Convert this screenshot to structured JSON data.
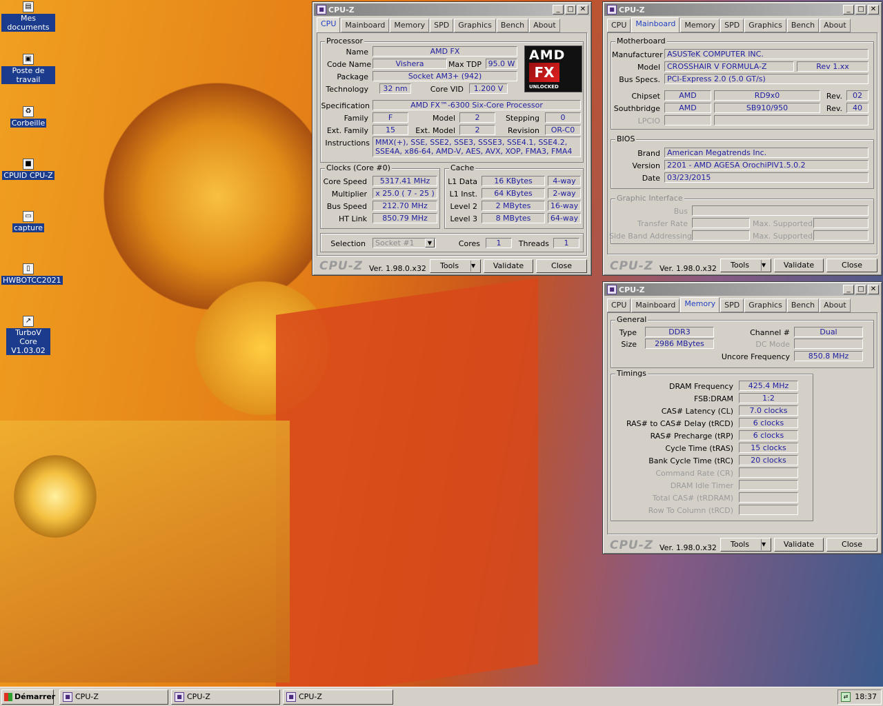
{
  "desktop": {
    "icons": [
      {
        "label": "Mes documents",
        "icon": "folder-icon"
      },
      {
        "label": "Poste de travail",
        "icon": "computer-icon"
      },
      {
        "label": "Corbeille",
        "icon": "recycle-bin-icon"
      },
      {
        "label": "CPUID CPU-Z",
        "icon": "cpuz-icon"
      },
      {
        "label": "capture",
        "icon": "screenshot-icon"
      },
      {
        "label": "HWBOTCC2021",
        "icon": "document-icon"
      },
      {
        "label": "TurboV Core V1.03.02",
        "icon": "turbov-icon"
      }
    ]
  },
  "app_title": "CPU-Z",
  "tab_labels": [
    "CPU",
    "Mainboard",
    "Memory",
    "SPD",
    "Graphics",
    "Bench",
    "About"
  ],
  "footer": {
    "logo": "CPU-Z",
    "version": "Ver. 1.98.0.x32",
    "tools": "Tools",
    "validate": "Validate",
    "close": "Close"
  },
  "cpu": {
    "processor_group": "Processor",
    "logo": {
      "brand": "AMD",
      "series": "FX",
      "badge": "UNLOCKED"
    },
    "labels": {
      "name": "Name",
      "code_name": "Code Name",
      "max_tdp": "Max TDP",
      "package": "Package",
      "technology": "Technology",
      "core_vid": "Core VID",
      "specification": "Specification",
      "family": "Family",
      "model": "Model",
      "stepping": "Stepping",
      "ext_family": "Ext. Family",
      "ext_model": "Ext. Model",
      "revision": "Revision",
      "instructions": "Instructions"
    },
    "name": "AMD FX",
    "code_name": "Vishera",
    "max_tdp": "95.0 W",
    "package": "Socket AM3+ (942)",
    "technology": "32 nm",
    "core_vid": "1.200 V",
    "specification": "AMD FX™-6300 Six-Core Processor",
    "family": "F",
    "model": "2",
    "stepping": "0",
    "ext_family": "15",
    "ext_model": "2",
    "revision": "OR-C0",
    "instructions": "MMX(+), SSE, SSE2, SSE3, SSSE3, SSE4.1, SSE4.2, SSE4A, x86-64, AMD-V, AES, AVX, XOP, FMA3, FMA4",
    "clocks": {
      "group": "Clocks (Core #0)",
      "core_speed_label": "Core Speed",
      "multiplier_label": "Multiplier",
      "bus_speed_label": "Bus Speed",
      "ht_link_label": "HT Link",
      "core_speed": "5317.41 MHz",
      "multiplier": "x 25.0 ( 7 - 25 )",
      "bus_speed": "212.70 MHz",
      "ht_link": "850.79 MHz"
    },
    "cache": {
      "group": "Cache",
      "l1d_label": "L1 Data",
      "l1i_label": "L1 Inst.",
      "l2_label": "Level 2",
      "l3_label": "Level 3",
      "l1d": "16 KBytes",
      "l1d_way": "4-way",
      "l1i": "64 KBytes",
      "l1i_way": "2-way",
      "l2": "2 MBytes",
      "l2_way": "16-way",
      "l3": "8 MBytes",
      "l3_way": "64-way"
    },
    "selection_label": "Selection",
    "selection": "Socket #1",
    "cores_label": "Cores",
    "cores": "1",
    "threads_label": "Threads",
    "threads": "1"
  },
  "mainboard": {
    "group": "Motherboard",
    "labels": {
      "manufacturer": "Manufacturer",
      "model": "Model",
      "bus_specs": "Bus Specs.",
      "chipset": "Chipset",
      "southbridge": "Southbridge",
      "lpcio": "LPCIO",
      "rev": "Rev."
    },
    "manufacturer": "ASUSTeK COMPUTER INC.",
    "model": "CROSSHAIR V FORMULA-Z",
    "model_rev": "Rev 1.xx",
    "bus_specs": "PCI-Express 2.0 (5.0 GT/s)",
    "chipset_vendor": "AMD",
    "chipset": "RD9x0",
    "chipset_rev": "02",
    "southbridge_vendor": "AMD",
    "southbridge": "SB910/950",
    "southbridge_rev": "40",
    "bios": {
      "group": "BIOS",
      "brand_label": "Brand",
      "version_label": "Version",
      "date_label": "Date",
      "brand": "American Megatrends Inc.",
      "version": "2201 - AMD AGESA OrochiPIV1.5.0.2",
      "date": "03/23/2015"
    },
    "graphic": {
      "group": "Graphic Interface",
      "bus": "Bus",
      "transfer_rate": "Transfer Rate",
      "max_supported": "Max. Supported",
      "side_band": "Side Band Addressing"
    }
  },
  "memory": {
    "general_group": "General",
    "labels": {
      "type": "Type",
      "size": "Size",
      "channel": "Channel #",
      "dc_mode": "DC Mode",
      "uncore": "Uncore Frequency"
    },
    "type": "DDR3",
    "size": "2986 MBytes",
    "channel": "Dual",
    "uncore": "850.8 MHz",
    "timings_group": "Timings",
    "timings": [
      {
        "label": "DRAM Frequency",
        "value": "425.4 MHz",
        "dim": false
      },
      {
        "label": "FSB:DRAM",
        "value": "1:2",
        "dim": false
      },
      {
        "label": "CAS# Latency (CL)",
        "value": "7.0 clocks",
        "dim": false
      },
      {
        "label": "RAS# to CAS# Delay (tRCD)",
        "value": "6 clocks",
        "dim": false
      },
      {
        "label": "RAS# Precharge (tRP)",
        "value": "6 clocks",
        "dim": false
      },
      {
        "label": "Cycle Time (tRAS)",
        "value": "15 clocks",
        "dim": false
      },
      {
        "label": "Bank Cycle Time (tRC)",
        "value": "20 clocks",
        "dim": false
      },
      {
        "label": "Command Rate (CR)",
        "value": "",
        "dim": true
      },
      {
        "label": "DRAM Idle Timer",
        "value": "",
        "dim": true
      },
      {
        "label": "Total CAS# (tRDRAM)",
        "value": "",
        "dim": true
      },
      {
        "label": "Row To Column (tRCD)",
        "value": "",
        "dim": true
      }
    ]
  },
  "taskbar": {
    "start": "Démarrer",
    "tasks": [
      "CPU-Z",
      "CPU-Z",
      "CPU-Z"
    ],
    "clock": "18:37"
  }
}
